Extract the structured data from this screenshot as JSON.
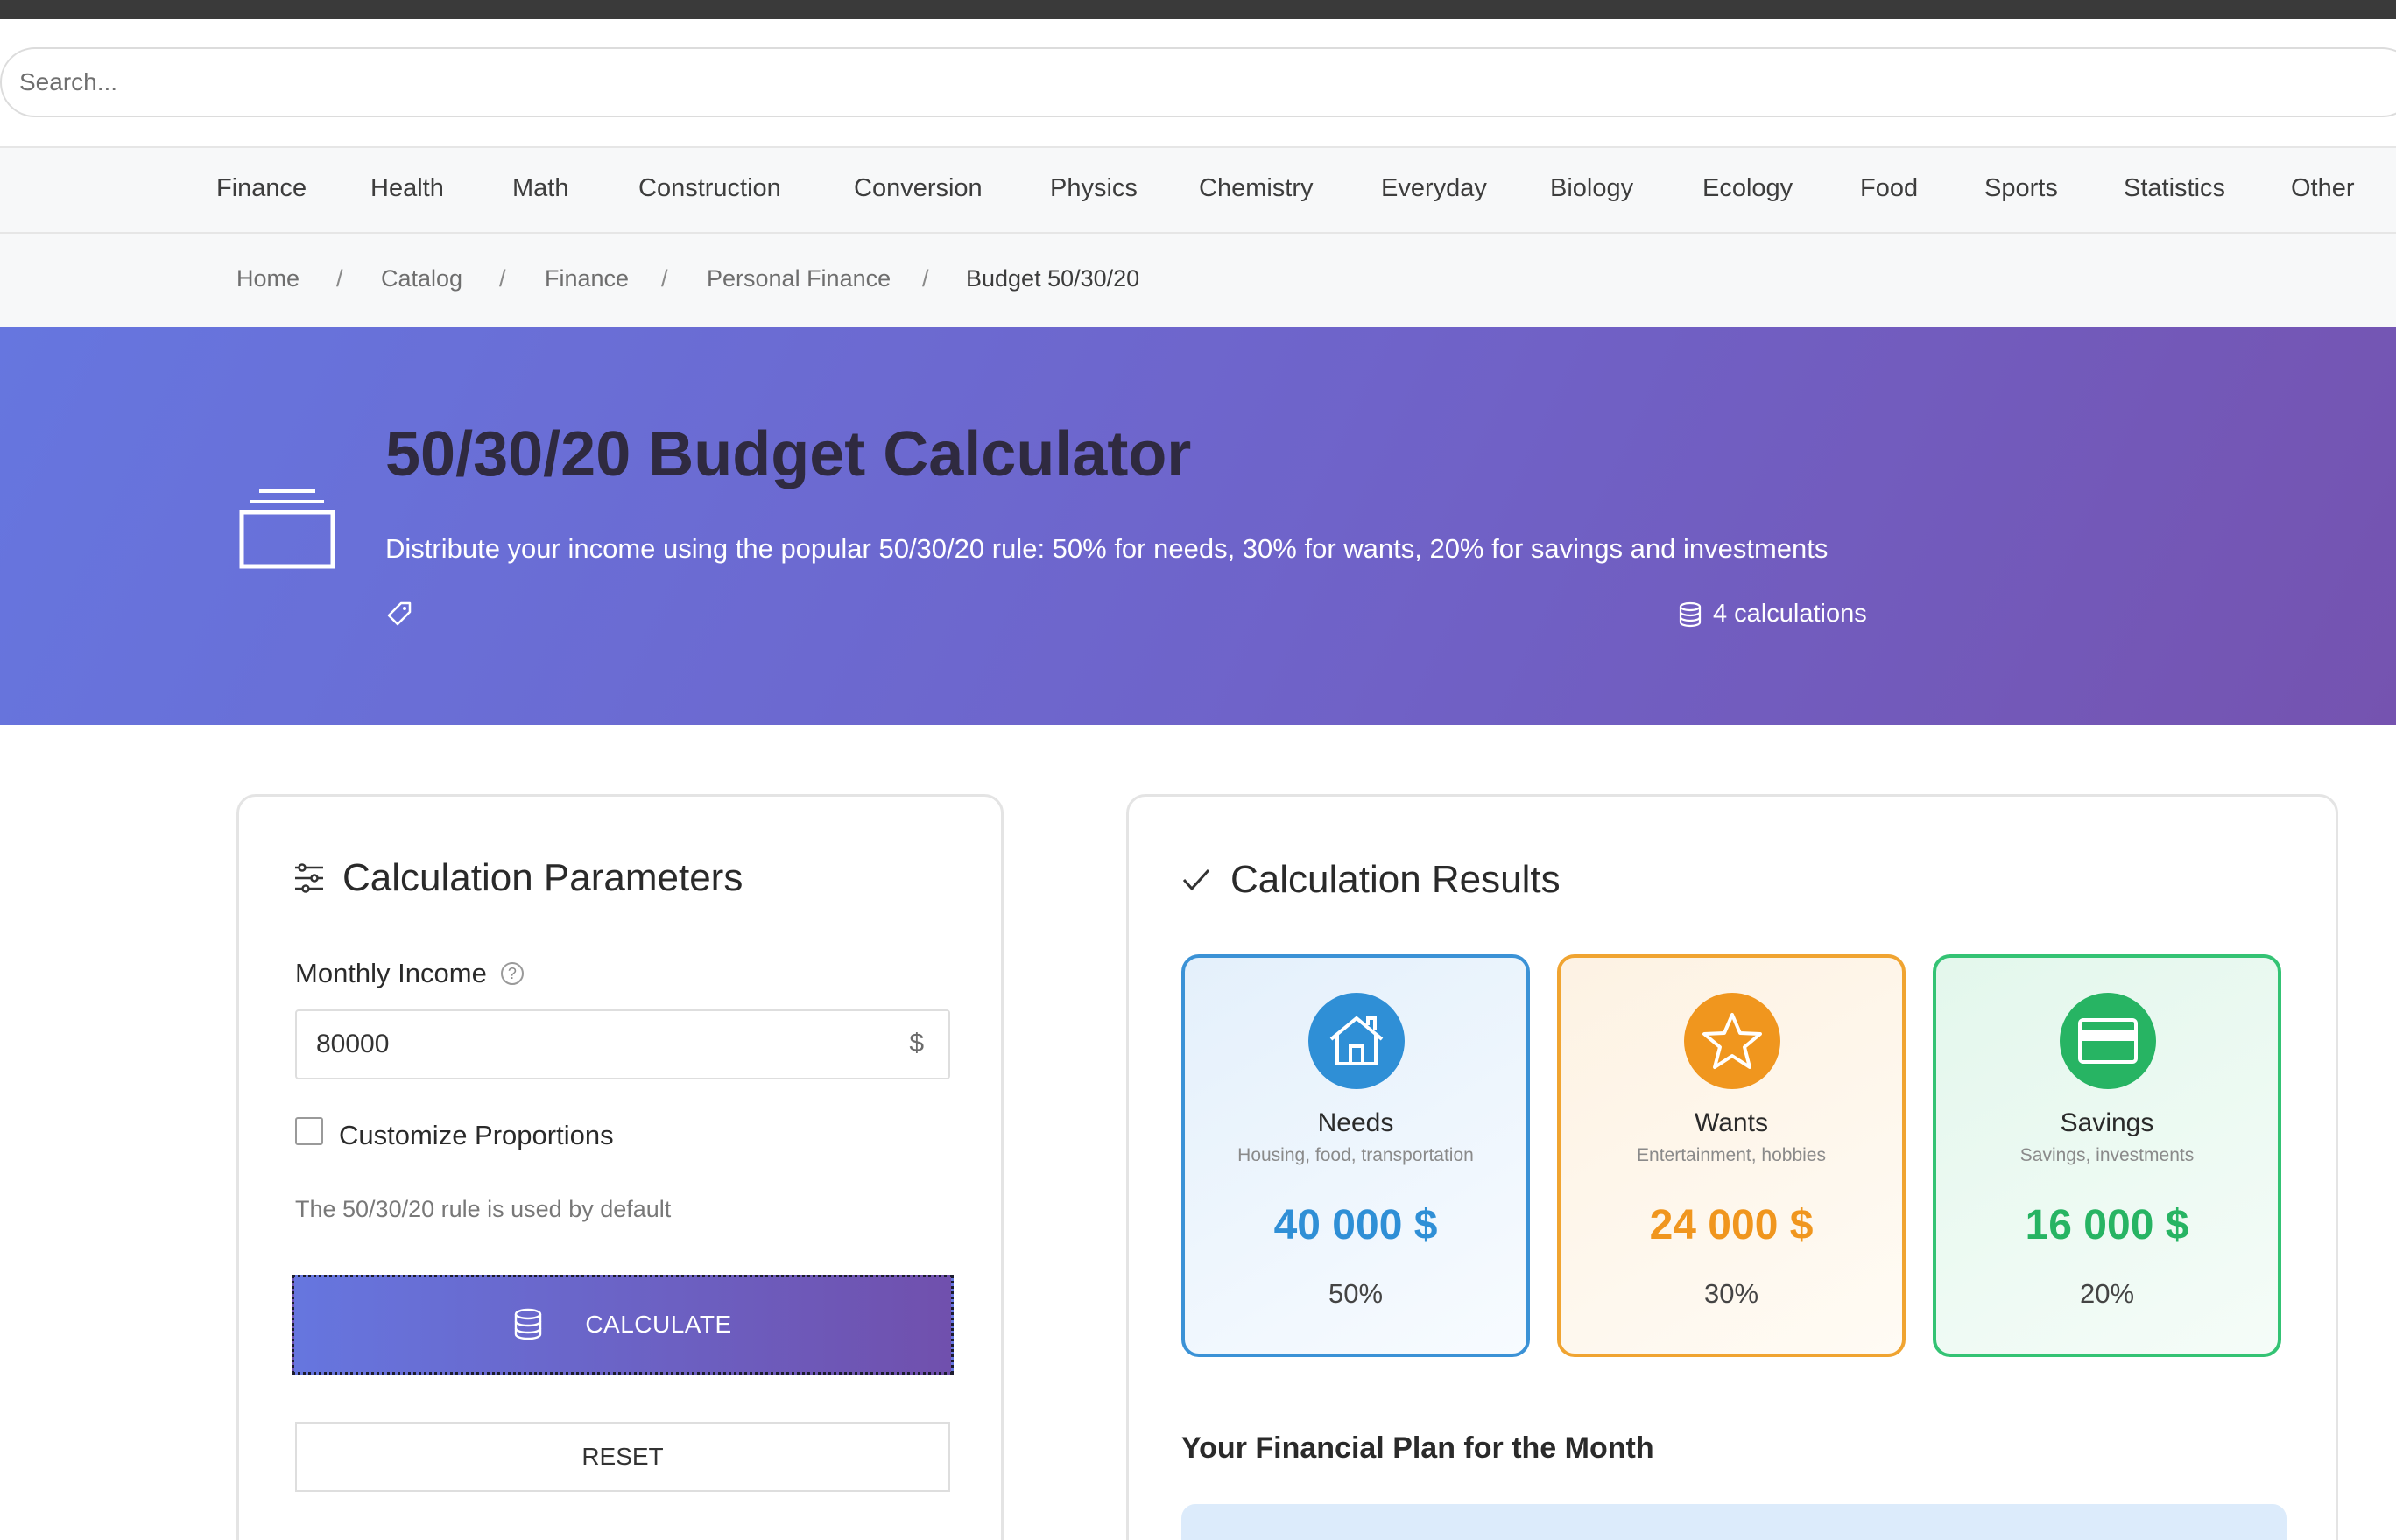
{
  "search": {
    "placeholder": "Search..."
  },
  "nav": {
    "items": [
      "Finance",
      "Health",
      "Math",
      "Construction",
      "Conversion",
      "Physics",
      "Chemistry",
      "Everyday",
      "Biology",
      "Ecology",
      "Food",
      "Sports",
      "Statistics",
      "Other"
    ]
  },
  "breadcrumb": {
    "items": [
      "Home",
      "Catalog",
      "Finance",
      "Personal Finance",
      "Budget 50/30/20"
    ],
    "separator": "/"
  },
  "hero": {
    "title": "50/30/20 Budget Calculator",
    "description": "Distribute your income using the popular 50/30/20 rule: 50% for needs, 30% for wants, 20% for savings and investments",
    "calculations": "4 calculations",
    "icons": {
      "main": "calculator-box-icon",
      "tag": "tag-icon",
      "calculations": "database-icon"
    }
  },
  "params": {
    "title": "Calculation Parameters",
    "icon": "sliders-icon",
    "income_label": "Monthly Income",
    "income_value": "80000",
    "currency": "$",
    "help_icon": "question-circle-icon",
    "customize_label": "Customize Proportions",
    "customize_checked": false,
    "hint": "The 50/30/20 rule is used by default",
    "calculate_label": "CALCULATE",
    "reset_label": "RESET"
  },
  "results": {
    "title": "Calculation Results",
    "icon": "check-icon",
    "cards": [
      {
        "name": "Needs",
        "desc": "Housing, food, transportation",
        "amount": "40 000 $",
        "pct": "50%",
        "color": "#2f8fd6",
        "icon": "house-icon"
      },
      {
        "name": "Wants",
        "desc": "Entertainment, hobbies",
        "amount": "24 000 $",
        "pct": "30%",
        "color": "#f0961e",
        "icon": "star-icon"
      },
      {
        "name": "Savings",
        "desc": "Savings, investments",
        "amount": "16 000 $",
        "pct": "20%",
        "color": "#27b463",
        "icon": "credit-card-icon"
      }
    ],
    "plan_title": "Your Financial Plan for the Month"
  },
  "colors": {
    "hero_start": "#6676df",
    "hero_end": "#7553b0",
    "needs": "#2f8fd6",
    "wants": "#f0961e",
    "savings": "#27b463"
  }
}
